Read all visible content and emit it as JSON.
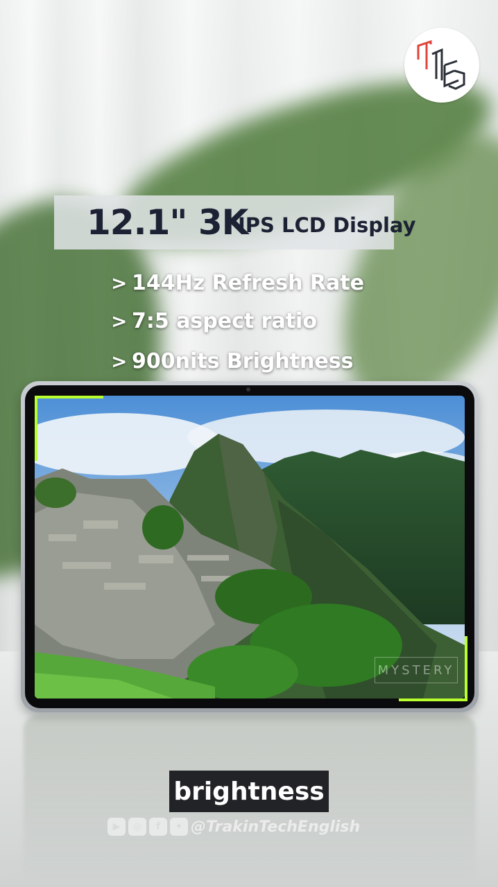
{
  "overlay": {
    "title_big": "12.1\" 3K",
    "title_small": "IPS LCD Display",
    "features": [
      {
        "chevron": ">",
        "text": "144Hz Refresh Rate"
      },
      {
        "chevron": ">",
        "text": "7:5 aspect ratio"
      },
      {
        "chevron": ">",
        "text": "900nits Brightness"
      }
    ],
    "accent_color": "#b9ff2e",
    "title_color": "#1c2233"
  },
  "screen": {
    "watermark": "MYSTERY"
  },
  "caption": {
    "text": "brightness"
  },
  "social": {
    "icons": [
      "youtube-icon",
      "instagram-icon",
      "facebook-icon",
      "twitter-icon"
    ],
    "handle": "@TrakinTechEnglish"
  },
  "logo": {
    "icon": "trakin-tech-logo-icon"
  }
}
